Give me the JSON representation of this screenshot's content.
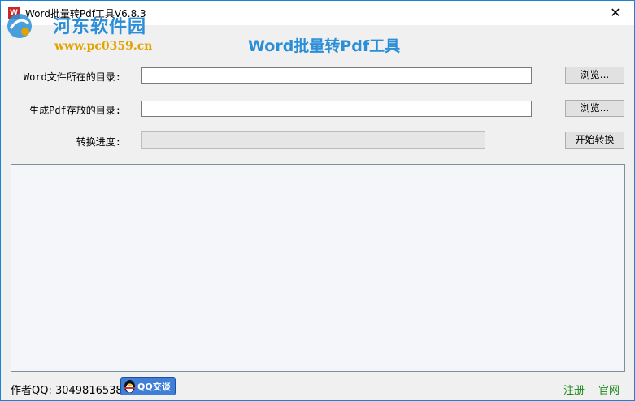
{
  "window": {
    "title": "Word批量转Pdf工具V6.8.3",
    "app_icon_text": "W",
    "close_glyph": "✕"
  },
  "watermark": {
    "title": "河东软件园",
    "url": "www.pc0359.cn"
  },
  "heading": "Word批量转Pdf工具",
  "form": {
    "word_dir_label": "Word文件所在的目录:",
    "word_dir_value": "",
    "pdf_dir_label": "生成Pdf存放的目录:",
    "pdf_dir_value": "",
    "progress_label": "转换进度:",
    "progress_percent": 0,
    "browse_label_1": "浏览...",
    "browse_label_2": "浏览...",
    "start_label": "开始转换"
  },
  "log": {
    "content": ""
  },
  "footer": {
    "author": "作者QQ: 3049816538",
    "qq_button_label": "QQ交谈",
    "register_link": "注册",
    "website_link": "官网"
  },
  "colors": {
    "heading": "#2b8fd8",
    "link": "#1a8a1a",
    "window_border": "#1883d7"
  }
}
